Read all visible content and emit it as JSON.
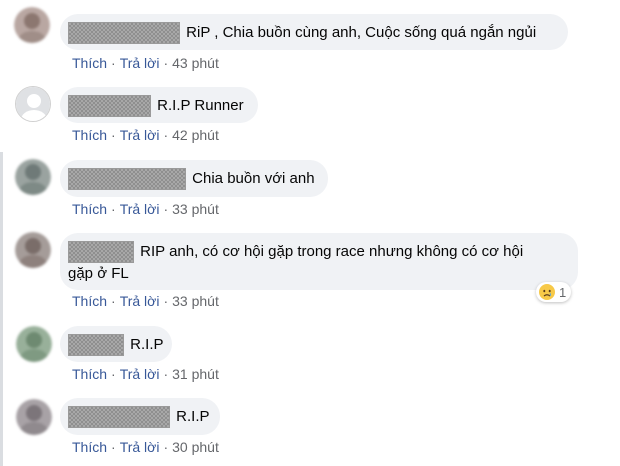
{
  "labels": {
    "like": "Thích",
    "reply": "Trả lời",
    "separator": "·"
  },
  "comments": [
    {
      "text": "RiP , Chia buồn cùng anh, Cuộc sống quá ngắn ngủi",
      "time": "43 phút",
      "avatar": "blurred-photo"
    },
    {
      "text": "R.I.P Runner",
      "time": "42 phút",
      "avatar": "default-silhouette"
    },
    {
      "text": "Chia buồn với anh",
      "time": "33 phút",
      "avatar": "blurred-photo"
    },
    {
      "text_line1": "RIP anh, có cơ hội gặp trong race nhưng không có cơ hội",
      "text_line2": "gặp ở FL",
      "time": "33 phút",
      "avatar": "blurred-photo",
      "reaction": {
        "icon": "sad-face-icon",
        "count": "1"
      }
    },
    {
      "text": "R.I.P",
      "time": "31 phút",
      "avatar": "blurred-photo"
    },
    {
      "text": "R.I.P",
      "time": "30 phút",
      "avatar": "blurred-photo"
    }
  ],
  "colors": {
    "bubble": "#f0f2f5",
    "link": "#385898",
    "meta": "#65676b",
    "text": "#050505"
  }
}
